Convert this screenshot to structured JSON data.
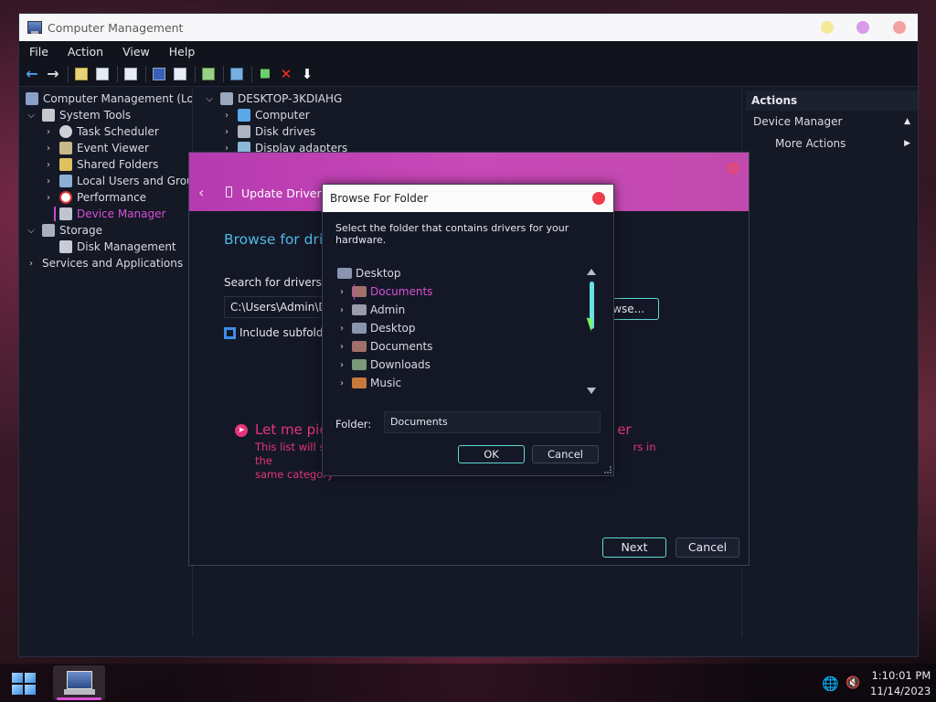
{
  "window": {
    "title": "Computer Management",
    "menu": [
      "File",
      "Action",
      "View",
      "Help"
    ]
  },
  "tree": {
    "root": "Computer Management (Local",
    "system_tools": "System Tools",
    "task_scheduler": "Task Scheduler",
    "event_viewer": "Event Viewer",
    "shared_folders": "Shared Folders",
    "local_users": "Local Users and Groups",
    "performance": "Performance",
    "device_manager": "Device Manager",
    "storage": "Storage",
    "disk_management": "Disk Management",
    "services": "Services and Applications"
  },
  "devices": {
    "host": "DESKTOP-3KDIAHG",
    "computer": "Computer",
    "disk_drives": "Disk drives",
    "display_adapters": "Display adapters"
  },
  "actions": {
    "header": "Actions",
    "device_manager": "Device Manager",
    "more_actions": "More Actions"
  },
  "wizard": {
    "title": "Update Drivers -",
    "heading": "Browse for drive",
    "search_label": "Search for drivers in t",
    "path": "C:\\Users\\Admin\\Doc",
    "browse": "owse...",
    "include_subfolders": "Include subfolder",
    "pick_title": "Let me pick",
    "pick_title_tail": "er",
    "pick_desc_1": "This list will sh",
    "pick_desc_1_tail": "rs in the",
    "pick_desc_2": "same category",
    "next": "Next",
    "cancel": "Cancel"
  },
  "browse_dialog": {
    "title": "Browse For Folder",
    "prompt": "Select the folder that contains drivers for your hardware.",
    "items": [
      "Desktop",
      "Documents",
      "Admin",
      "Desktop",
      "Documents",
      "Downloads",
      "Music"
    ],
    "folder_label": "Folder:",
    "folder_value": "Documents",
    "ok": "OK",
    "cancel": "Cancel"
  },
  "taskbar": {
    "time": "1:10:01 PM",
    "date": "11/14/2023"
  },
  "colors": {
    "accent_magenta": "#d84fd6",
    "accent_cyan": "#5ed8d4",
    "header_gradient": "#c849b8",
    "link_pink": "#e6357a"
  }
}
